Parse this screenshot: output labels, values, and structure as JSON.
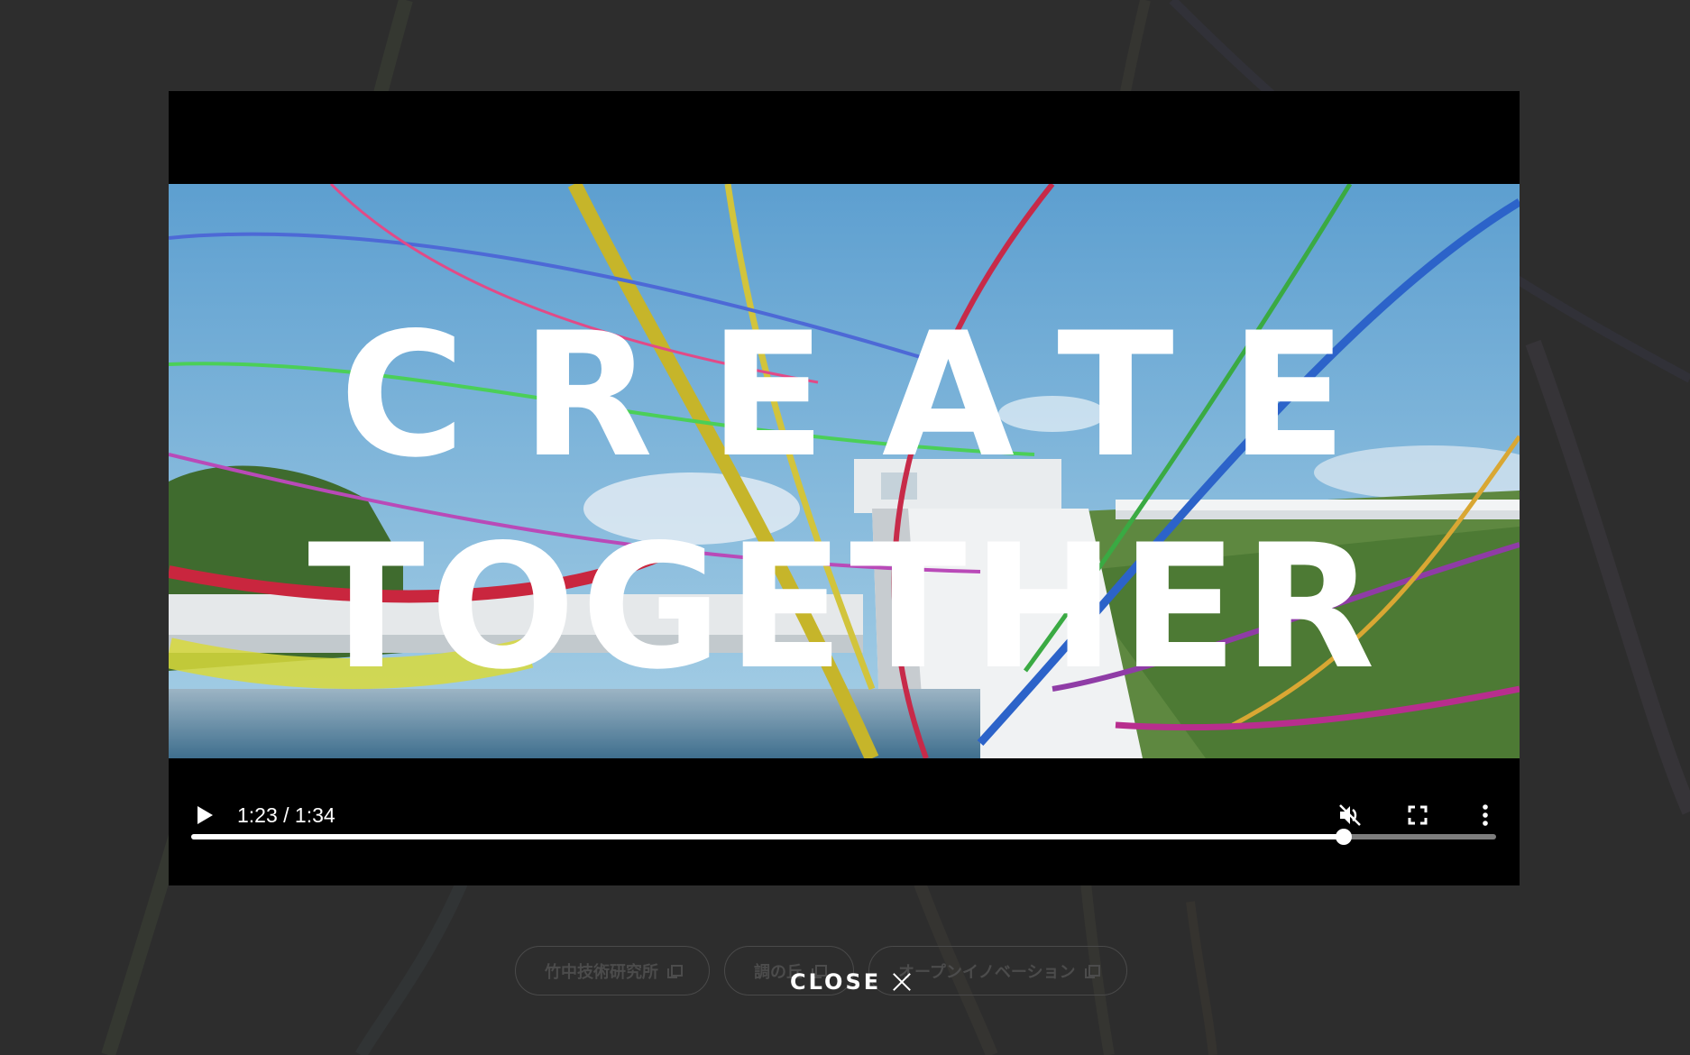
{
  "background": {
    "links": [
      {
        "label": "竹中技術研究所"
      },
      {
        "label": "調の丘"
      },
      {
        "label": "オープンイノベーション"
      }
    ]
  },
  "video": {
    "headline_line1": "CREATE",
    "headline_line2": "TOGETHER",
    "progress_fraction": 0.883
  },
  "controls": {
    "time": "1:23 / 1:34",
    "play_icon": "play-icon",
    "mute_icon": "volume-muted-icon",
    "fullscreen_icon": "fullscreen-icon",
    "more_icon": "more-vertical-icon"
  },
  "close": {
    "label": "CLOSE"
  }
}
